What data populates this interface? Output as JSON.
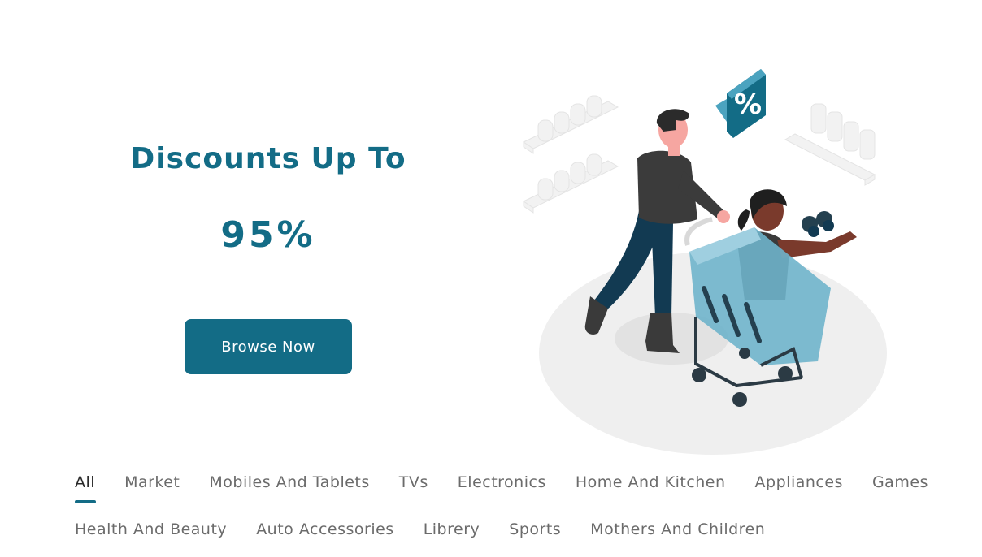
{
  "hero": {
    "title": "Discounts Up To",
    "percent": "95%",
    "button_label": "Browse Now"
  },
  "illustration": {
    "badge_symbol": "%"
  },
  "categories": {
    "row1": [
      "All",
      "Market",
      "Mobiles And Tablets",
      "TVs",
      "Electronics",
      "Home And Kitchen",
      "Appliances",
      "Games"
    ],
    "row2": [
      "Health And Beauty",
      "Auto Accessories",
      "Librery",
      "Sports",
      "Mothers And Children"
    ],
    "active": "All"
  },
  "colors": {
    "accent": "#136c86",
    "text_muted": "#6b6b6b",
    "text_active": "#2b2b2b"
  }
}
